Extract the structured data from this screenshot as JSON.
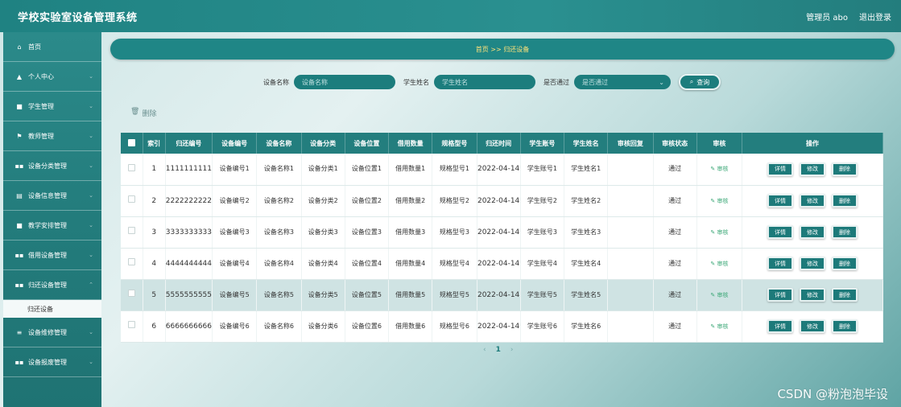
{
  "header": {
    "app_title": "学校实验室设备管理系统",
    "user": "管理员 abo",
    "logout": "退出登录"
  },
  "sidebar": {
    "items": [
      {
        "icon": "home-icon",
        "glyph": "⌂",
        "label": "首页"
      },
      {
        "icon": "user-icon",
        "glyph": "▲",
        "label": "个人中心"
      },
      {
        "icon": "student-icon",
        "glyph": "■",
        "label": "学生管理"
      },
      {
        "icon": "flag-icon",
        "glyph": "⚑",
        "label": "教师管理"
      },
      {
        "icon": "grid-icon",
        "glyph": "▪▪",
        "label": "设备分类管理"
      },
      {
        "icon": "list-icon",
        "glyph": "▤",
        "label": "设备信息管理"
      },
      {
        "icon": "lock-icon",
        "glyph": "■",
        "label": "教学安排管理"
      },
      {
        "icon": "grid-icon",
        "glyph": "▪▪",
        "label": "借用设备管理"
      },
      {
        "icon": "grid-icon",
        "glyph": "▪▪",
        "label": "归还设备管理"
      },
      {
        "icon": "menu-icon",
        "glyph": "≡",
        "label": "设备维修管理"
      },
      {
        "icon": "grid-icon",
        "glyph": "▪▪",
        "label": "设备报废管理"
      }
    ],
    "active_sub": "归还设备"
  },
  "breadcrumb": {
    "home": "首页",
    "sep": ">>",
    "current": "归还设备"
  },
  "search": {
    "device_name_label": "设备名称",
    "device_name_placeholder": "设备名称",
    "student_name_label": "学生姓名",
    "student_name_placeholder": "学生姓名",
    "passed_label": "是否通过",
    "passed_value": "是否通过",
    "query_button": "查询"
  },
  "delete_label": "删除",
  "table": {
    "headers": [
      "索引",
      "归还编号",
      "设备编号",
      "设备名称",
      "设备分类",
      "设备位置",
      "借用数量",
      "规格型号",
      "归还时间",
      "学生账号",
      "学生姓名",
      "审核回复",
      "审核状态",
      "审核",
      "操作"
    ],
    "rows": [
      {
        "idx": "1",
        "code": "1111111111",
        "dev_no": "设备编号1",
        "dev_name": "设备名称1",
        "cat": "设备分类1",
        "loc": "设备位置1",
        "qty": "借用数量1",
        "spec": "规格型号1",
        "time": "2022-04-14",
        "acct": "学生账号1",
        "stu": "学生姓名1",
        "reply": "",
        "status": "通过",
        "audit": "审核"
      },
      {
        "idx": "2",
        "code": "2222222222",
        "dev_no": "设备编号2",
        "dev_name": "设备名称2",
        "cat": "设备分类2",
        "loc": "设备位置2",
        "qty": "借用数量2",
        "spec": "规格型号2",
        "time": "2022-04-14",
        "acct": "学生账号2",
        "stu": "学生姓名2",
        "reply": "",
        "status": "通过",
        "audit": "审核"
      },
      {
        "idx": "3",
        "code": "3333333333",
        "dev_no": "设备编号3",
        "dev_name": "设备名称3",
        "cat": "设备分类3",
        "loc": "设备位置3",
        "qty": "借用数量3",
        "spec": "规格型号3",
        "time": "2022-04-14",
        "acct": "学生账号3",
        "stu": "学生姓名3",
        "reply": "",
        "status": "通过",
        "audit": "审核"
      },
      {
        "idx": "4",
        "code": "4444444444",
        "dev_no": "设备编号4",
        "dev_name": "设备名称4",
        "cat": "设备分类4",
        "loc": "设备位置4",
        "qty": "借用数量4",
        "spec": "规格型号4",
        "time": "2022-04-14",
        "acct": "学生账号4",
        "stu": "学生姓名4",
        "reply": "",
        "status": "通过",
        "audit": "审核"
      },
      {
        "idx": "5",
        "code": "5555555555",
        "dev_no": "设备编号5",
        "dev_name": "设备名称5",
        "cat": "设备分类5",
        "loc": "设备位置5",
        "qty": "借用数量5",
        "spec": "规格型号5",
        "time": "2022-04-14",
        "acct": "学生账号5",
        "stu": "学生姓名5",
        "reply": "",
        "status": "通过",
        "audit": "审核"
      },
      {
        "idx": "6",
        "code": "6666666666",
        "dev_no": "设备编号6",
        "dev_name": "设备名称6",
        "cat": "设备分类6",
        "loc": "设备位置6",
        "qty": "借用数量6",
        "spec": "规格型号6",
        "time": "2022-04-14",
        "acct": "学生账号6",
        "stu": "学生姓名6",
        "reply": "",
        "status": "通过",
        "audit": "审核"
      }
    ],
    "highlight_row": 5,
    "op_labels": {
      "detail": "详情",
      "edit": "修改",
      "delete": "删除"
    }
  },
  "pagination": {
    "prev": "‹",
    "current": "1",
    "next": "›"
  },
  "watermark": "CSDN @粉泡泡毕设",
  "colors": {
    "primary": "#237e7e",
    "breadcrumb_text": "#ffe27a",
    "audit_link": "#3aa776"
  }
}
